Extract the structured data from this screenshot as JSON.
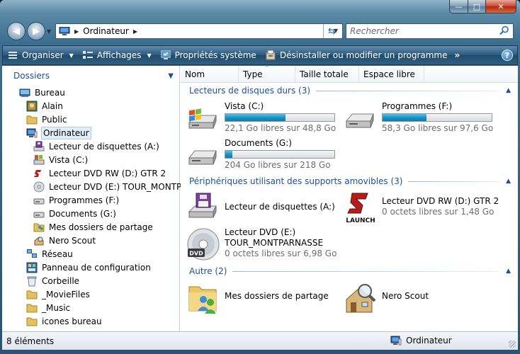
{
  "window": {
    "minimize": "—",
    "maximize": "□",
    "close": "✕"
  },
  "address": {
    "location": "Ordinateur",
    "search_placeholder": "Rechercher"
  },
  "toolbar": {
    "organize": "Organiser",
    "views": "Affichages",
    "system_properties": "Propriétés système",
    "uninstall": "Désinstaller ou modifier un programme",
    "more": "»",
    "help": "?"
  },
  "nav": {
    "header": "Dossiers",
    "items": [
      {
        "label": "Bureau"
      },
      {
        "label": "Alain"
      },
      {
        "label": "Public"
      },
      {
        "label": "Ordinateur"
      },
      {
        "label": "Lecteur de disquettes (A:)"
      },
      {
        "label": "Vista (C:)"
      },
      {
        "label": "Lecteur DVD RW (D:) GTR 2"
      },
      {
        "label": "Lecteur DVD (E:) TOUR_MONTPAR"
      },
      {
        "label": "Programmes (F:)"
      },
      {
        "label": "Documents (G:)"
      },
      {
        "label": "Mes dossiers de partage"
      },
      {
        "label": "Nero Scout"
      },
      {
        "label": "Réseau"
      },
      {
        "label": "Panneau de configuration"
      },
      {
        "label": "Corbeille"
      },
      {
        "label": "_MovieFiles"
      },
      {
        "label": "_Music"
      },
      {
        "label": "icones bureau"
      }
    ]
  },
  "columns": [
    "Nom",
    "Type",
    "Taille totale",
    "Espace libre"
  ],
  "groups": {
    "hdd": "Lecteurs de disques durs (3)",
    "removable": "Périphériques utilisant des supports amovibles (3)",
    "other": "Autre (2)"
  },
  "drives": [
    {
      "name": "Vista (C:)",
      "free": "22,1 Go libres sur 48,8 Go",
      "used_fraction": 0.55
    },
    {
      "name": "Programmes (F:)",
      "free": "58,3 Go libres sur 97,6 Go",
      "used_fraction": 0.4
    },
    {
      "name": "Documents (G:)",
      "free": "204 Go libres sur 218 Go",
      "used_fraction": 0.065
    }
  ],
  "removable": [
    {
      "name": "Lecteur de disquettes (A:)"
    },
    {
      "name": "Lecteur DVD RW (D:) GTR 2",
      "free": "0 octets libres sur 1,48 Go",
      "badge": "LAUNCH"
    },
    {
      "name1": "Lecteur DVD (E:)",
      "name2": "TOUR_MONTPARNASSE",
      "free": "0 octets libres sur 6,98 Go",
      "badge": "DVD"
    }
  ],
  "other": [
    {
      "name": "Mes dossiers de partage"
    },
    {
      "name": "Nero Scout"
    }
  ],
  "status": {
    "count": "8 éléments",
    "location": "Ordinateur"
  },
  "colors": {
    "accent": "#1f4e9a",
    "bar_fill": "#1a8fc3",
    "toolbar": "#2b587b"
  }
}
